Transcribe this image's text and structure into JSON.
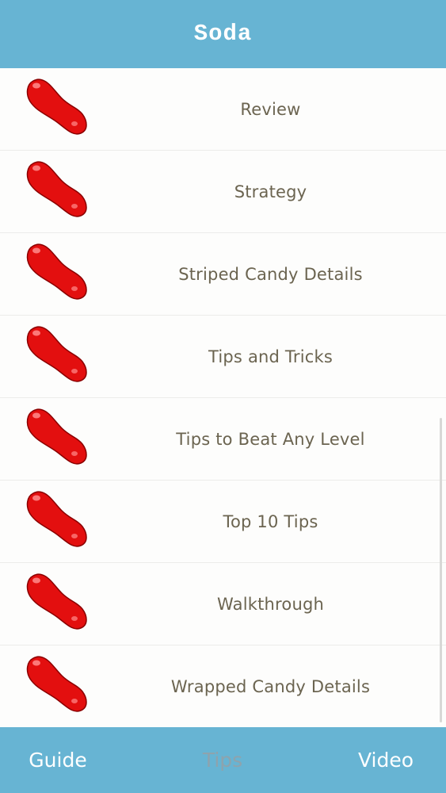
{
  "nav": {
    "title": "Soda"
  },
  "list": {
    "items": [
      {
        "label": "Review",
        "icon": "red-jelly-bean-icon"
      },
      {
        "label": "Strategy",
        "icon": "red-jelly-bean-icon"
      },
      {
        "label": "Striped Candy Details",
        "icon": "red-jelly-bean-icon"
      },
      {
        "label": "Tips and Tricks",
        "icon": "red-jelly-bean-icon"
      },
      {
        "label": "Tips to Beat Any Level",
        "icon": "red-jelly-bean-icon"
      },
      {
        "label": "Top 10 Tips",
        "icon": "red-jelly-bean-icon"
      },
      {
        "label": "Walkthrough",
        "icon": "red-jelly-bean-icon"
      },
      {
        "label": "Wrapped Candy Details",
        "icon": "red-jelly-bean-icon"
      }
    ]
  },
  "tabs": {
    "guide": "Guide",
    "tips": "Tips",
    "video": "Video",
    "selected": "Tips"
  },
  "colors": {
    "bar": "#67b4d3",
    "label_text": "#6b6450",
    "tab_active": "#8ea3ad",
    "candy": "#e30f0f"
  }
}
